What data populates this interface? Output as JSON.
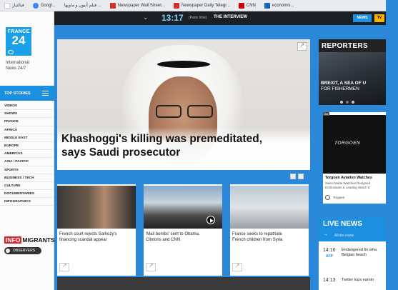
{
  "bookmarks": [
    {
      "label": "فيالتيار",
      "color": "#ffffff"
    },
    {
      "label": "Googl...",
      "color": "#4285f4"
    },
    {
      "label": "فيلم أنيون و ماويها ...",
      "color": "#eeeeee"
    },
    {
      "label": "Newspaper Wall Street...",
      "color": "#d32f2f"
    },
    {
      "label": "Newspaper Daily Telegr...",
      "color": "#d32f2f"
    },
    {
      "label": "CNN",
      "color": "#cc0000"
    },
    {
      "label": "economis...",
      "color": "#1565c0"
    }
  ],
  "sidebar": {
    "logo_top": "FRANCE",
    "logo_num": "24",
    "tagline_1": "International",
    "tagline_2": "News 24/7",
    "top_stories": "TOP STORIES",
    "nav": [
      "VIDEOS",
      "SHOWS",
      "FRANCE",
      "AFRICA",
      "MIDDLE EAST",
      "EUROPE",
      "AMERICAS",
      "ASIA / PACIFIC",
      "SPORTS",
      "BUSINESS / TECH",
      "CULTURE",
      "DOCUMENTARIES",
      "INFOGRAPHICS"
    ],
    "info": "INFO",
    "migrants": "MIGRANTS",
    "observers": "OBSERVERS"
  },
  "topbar": {
    "chevron": "⌄",
    "time": "13:17",
    "paris_time": "(Paris time)",
    "program": "THE INTERVIEW",
    "news_btn": "NEWS",
    "tv_btn": "TV"
  },
  "hero": {
    "headline_1": "Khashoggi's killing was premeditated,",
    "headline_2": "says Saudi prosecutor"
  },
  "cards": [
    {
      "caption_1": "French court rejects Sarkozy's",
      "caption_2": "financing scandal appeal"
    },
    {
      "caption_1": "'Mail bombs' sent to Obama,",
      "caption_2": "Clintons and CNN"
    },
    {
      "caption_1": "France seeks to repatriate",
      "caption_2": "French children from Syria"
    }
  ],
  "reporters": {
    "logo": "REPORTERS",
    "cap_1": "BREXIT, A SEA OF U",
    "cap_2": "FOR FISHERMEN"
  },
  "ad": {
    "tag": "Ad",
    "brand": "TORGOEN",
    "title": "Torgoen Aviation Watches",
    "desc_1": "Swiss Made Watches Designed",
    "desc_2": "Enthusiasts & Leading Watch E",
    "advertiser": "Torgoen"
  },
  "live_news": {
    "title": "LIVE NEWS",
    "all": "All the news",
    "items": [
      {
        "time": "14:16",
        "source": "AFP",
        "text_1": "Endangered fin wha",
        "text_2": "Belgian beach"
      },
      {
        "time": "14:13",
        "source": "",
        "text_1": "Twitter tops earnin",
        "text_2": ""
      }
    ]
  }
}
